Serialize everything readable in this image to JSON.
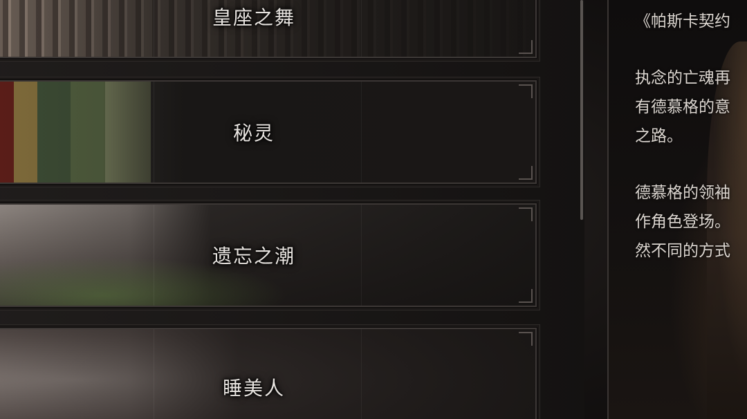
{
  "list": {
    "items": [
      {
        "title": "皇座之舞"
      },
      {
        "title": "秘灵"
      },
      {
        "title": "遗忘之潮"
      },
      {
        "title": "睡美人"
      }
    ]
  },
  "description": {
    "line_1": "《帕斯卡契约",
    "para_2": [
      "执念的亡魂再",
      "有德慕格的意",
      "之路。"
    ],
    "para_3": [
      "德慕格的领袖",
      "作角色登场。",
      "然不同的方式"
    ]
  }
}
